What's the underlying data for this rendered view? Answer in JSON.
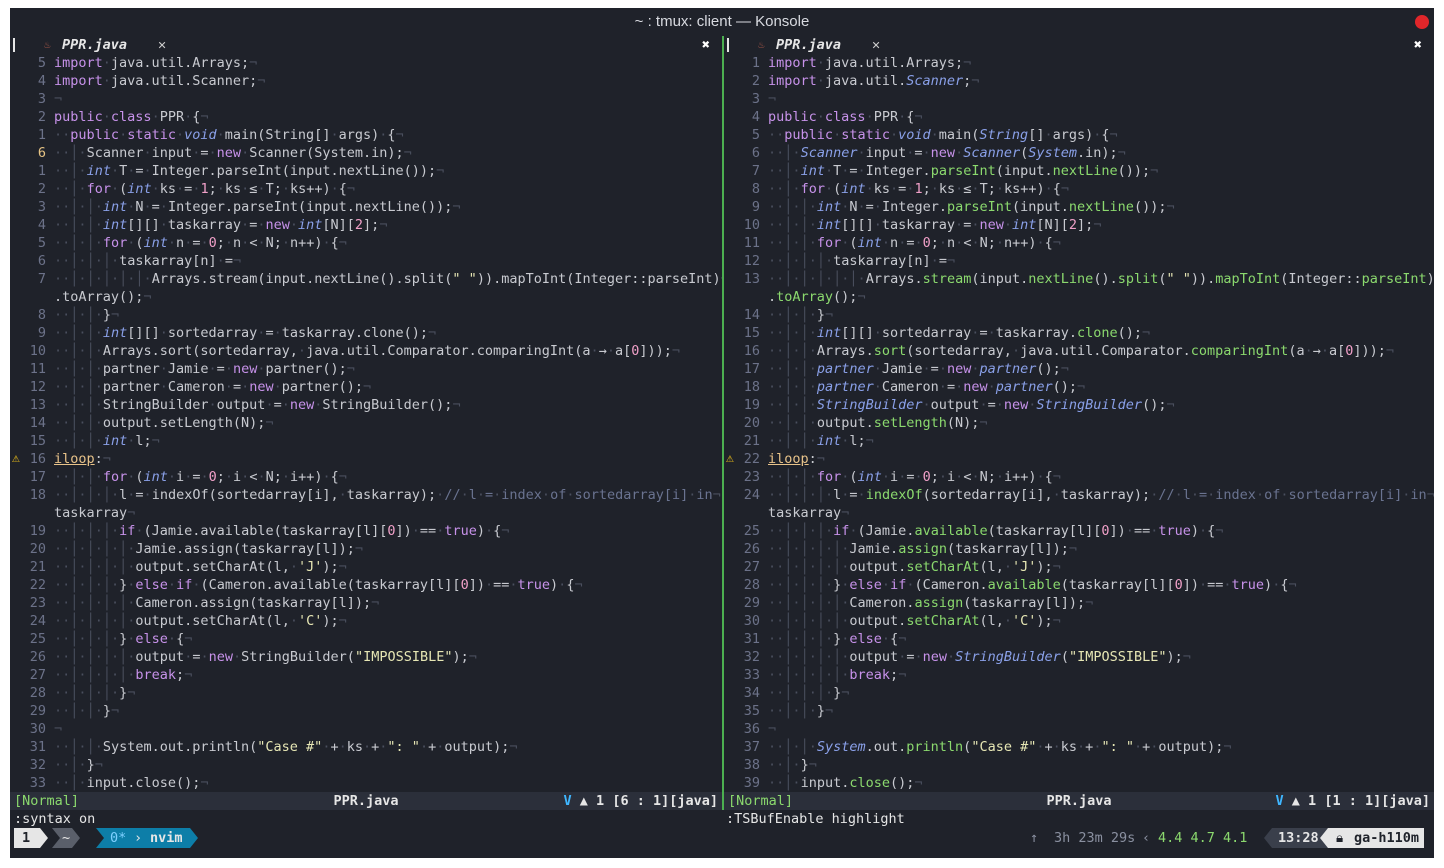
{
  "window": {
    "title": "~ : tmux: client — Konsole"
  },
  "left_pane": {
    "tab": {
      "filename": "PPR.java",
      "x": "✕",
      "close": "✖"
    },
    "status": {
      "mode": "[Normal]",
      "file": "PPR.java",
      "v": "V",
      "diag": "▲ 1",
      "pos": "[6 : 1][java]"
    },
    "command": ":syntax on"
  },
  "right_pane": {
    "tab": {
      "filename": "PPR.java",
      "x": "✕",
      "close": "✖"
    },
    "status": {
      "mode": "[Normal]",
      "file": "PPR.java",
      "v": "V",
      "diag": "▲ 1",
      "pos": "[1 : 1][java]"
    },
    "command": ":TSBufEnable highlight"
  },
  "tmux": {
    "session": "1",
    "home": "~",
    "window_index": "0*",
    "window_name": "nvim",
    "uptime": "3h 23m 29s",
    "load": "4.4 4.7 4.1",
    "time": "13:28",
    "host": "ga-h110m"
  },
  "code": {
    "left_numbers": [
      "5",
      "4",
      "3",
      "2",
      "1",
      "6",
      "1",
      "2",
      "3",
      "4",
      "5",
      "6",
      "7",
      "",
      "8",
      "9",
      "10",
      "11",
      "12",
      "13",
      "14",
      "15",
      "16",
      "17",
      "18",
      "",
      "19",
      "20",
      "21",
      "22",
      "23",
      "24",
      "25",
      "26",
      "27",
      "28",
      "29",
      "30",
      "31",
      "32",
      "33"
    ],
    "right_numbers": [
      "1",
      "2",
      "3",
      "4",
      "5",
      "6",
      "7",
      "8",
      "9",
      "10",
      "11",
      "12",
      "13",
      "",
      "14",
      "15",
      "16",
      "17",
      "18",
      "19",
      "20",
      "21",
      "22",
      "23",
      "24",
      "",
      "25",
      "26",
      "27",
      "28",
      "29",
      "30",
      "31",
      "32",
      "33",
      "34",
      "35",
      "36",
      "37",
      "38",
      "39"
    ],
    "lines": [
      "import java.util.Arrays;",
      "import java.util.Scanner;",
      "",
      "public class PPR {",
      "  public static void main(String[] args) {",
      "    Scanner input = new Scanner(System.in);",
      "    int T = Integer.parseInt(input.nextLine());",
      "    for (int ks = 1; ks ≤ T; ks++) {",
      "      int N = Integer.parseInt(input.nextLine());",
      "      int[][] taskarray = new int[N][2];",
      "      for (int n = 0; n < N; n++) {",
      "        taskarray[n] =",
      "            Arrays.stream(input.nextLine().split(\" \")).mapToInt(Integer::parseInt)",
      ".toArray();",
      "      }",
      "      int[][] sortedarray = taskarray.clone();",
      "      Arrays.sort(sortedarray, java.util.Comparator.comparingInt(a → a[0]));",
      "      partner Jamie = new partner();",
      "      partner Cameron = new partner();",
      "      StringBuilder output = new StringBuilder();",
      "      output.setLength(N);",
      "      int l;",
      "iloop:",
      "      for (int i = 0; i < N; i++) {",
      "        l = indexOf(sortedarray[i], taskarray); // l = index of sortedarray[i] in",
      "taskarray",
      "        if (Jamie.available(taskarray[l][0]) == true) {",
      "          Jamie.assign(taskarray[l]);",
      "          output.setCharAt(l, 'J');",
      "        } else if (Cameron.available(taskarray[l][0]) == true) {",
      "          Cameron.assign(taskarray[l]);",
      "          output.setCharAt(l, 'C');",
      "        } else {",
      "          output = new StringBuilder(\"IMPOSSIBLE\");",
      "          break;",
      "        }",
      "      }",
      "",
      "      System.out.println(\"Case #\" + ks + \": \" + output);",
      "    }",
      "    input.close();"
    ]
  }
}
